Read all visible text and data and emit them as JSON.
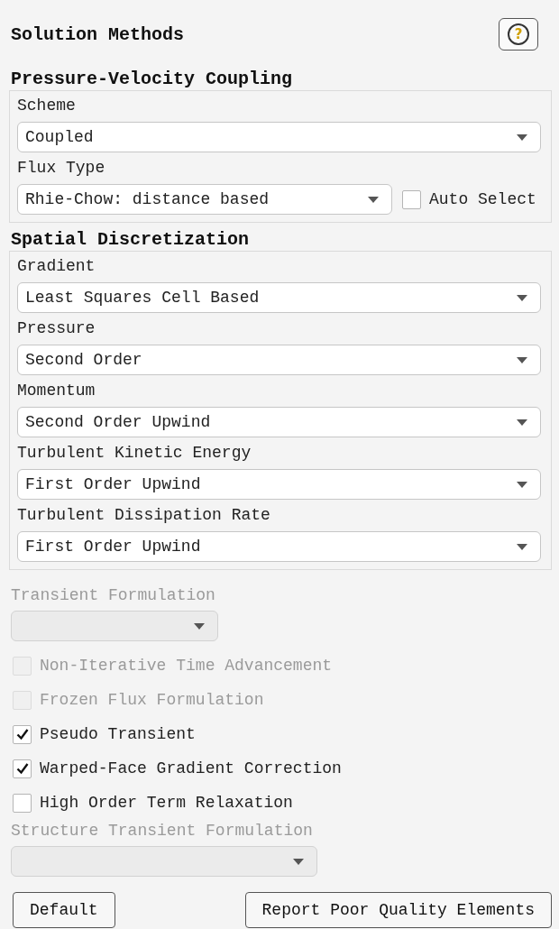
{
  "title": "Solution Methods",
  "help_button": {
    "symbol": "?"
  },
  "sections": [
    {
      "title": "Pressure-Velocity Coupling",
      "fields": [
        {
          "label": "Scheme",
          "value": "Coupled"
        },
        {
          "label": "Flux Type",
          "value": "Rhie-Chow: distance based",
          "checkbox": {
            "label": "Auto Select",
            "checked": false
          }
        }
      ]
    },
    {
      "title": "Spatial Discretization",
      "fields": [
        {
          "label": "Gradient",
          "value": "Least Squares Cell Based"
        },
        {
          "label": "Pressure",
          "value": "Second Order"
        },
        {
          "label": "Momentum",
          "value": "Second Order Upwind"
        },
        {
          "label": "Turbulent Kinetic Energy",
          "value": "First Order Upwind"
        },
        {
          "label": "Turbulent Dissipation Rate",
          "value": "First Order Upwind"
        }
      ]
    }
  ],
  "transient_formulation": {
    "label": "Transient Formulation",
    "disabled": true
  },
  "options": [
    {
      "label": "Non-Iterative Time Advancement",
      "checked": false,
      "disabled": true
    },
    {
      "label": "Frozen Flux Formulation",
      "checked": false,
      "disabled": true
    },
    {
      "label": "Pseudo Transient",
      "checked": true,
      "disabled": false
    },
    {
      "label": "Warped-Face Gradient Correction",
      "checked": true,
      "disabled": false
    },
    {
      "label": "High Order Term Relaxation",
      "checked": false,
      "disabled": false
    }
  ],
  "structure_transient_formulation": {
    "label": "Structure Transient Formulation",
    "disabled": true
  },
  "buttons": [
    "Default",
    "Report Poor Quality Elements"
  ]
}
